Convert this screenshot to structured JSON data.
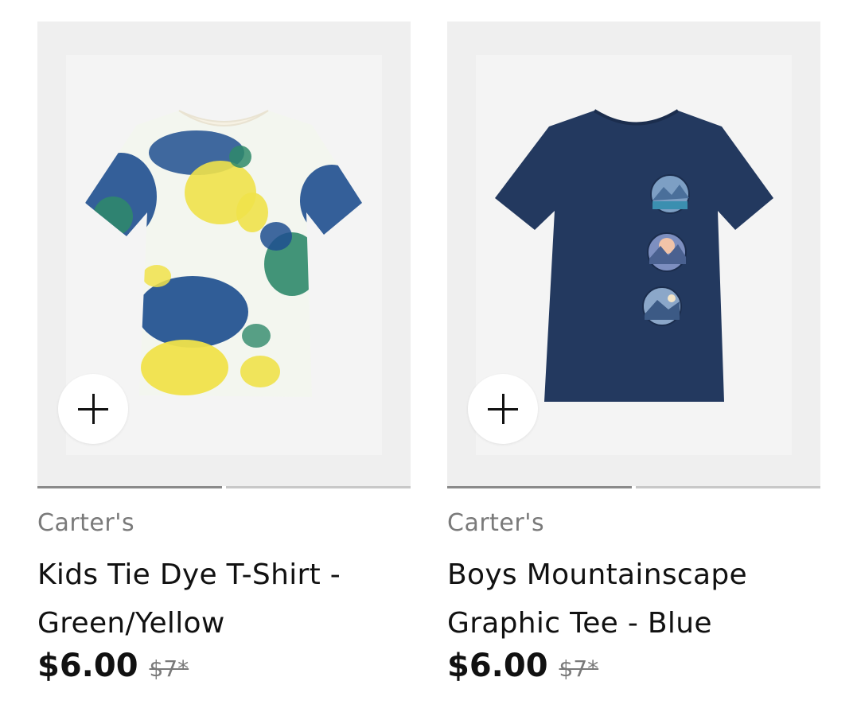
{
  "products": [
    {
      "brand": "Carter's",
      "title": "Kids Tie Dye T-Shirt - Green/Yellow",
      "price": "$6.00",
      "original_price": "$7*",
      "add_icon": "plus-icon",
      "carousel": {
        "total": 2,
        "active": 1
      }
    },
    {
      "brand": "Carter's",
      "title": "Boys Mountainscape Graphic Tee - Blue",
      "price": "$6.00",
      "original_price": "$7*",
      "add_icon": "plus-icon",
      "carousel": {
        "total": 2,
        "active": 1
      }
    }
  ],
  "colors": {
    "image_bg": "#efefef",
    "tee_navy": "#23395f",
    "tie_dye_blue": "#1f4f8f",
    "tie_dye_yellow": "#f0e24a",
    "tie_dye_green": "#2f8a6a"
  }
}
